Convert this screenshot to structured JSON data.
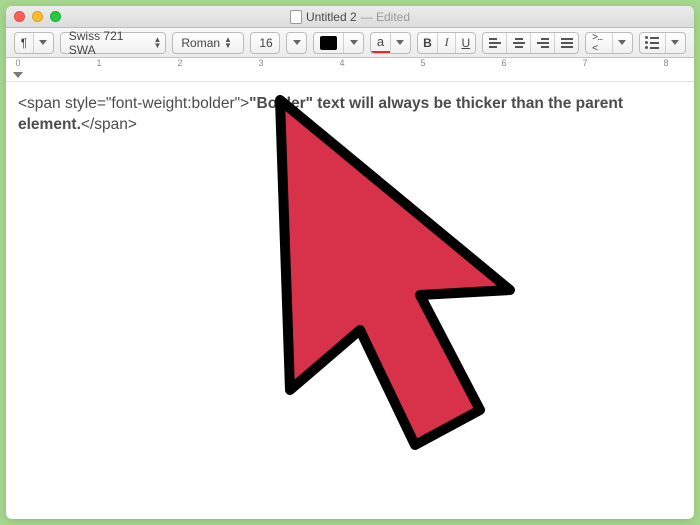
{
  "window": {
    "doc_title": "Untitled 2",
    "edited_suffix": "— Edited"
  },
  "toolbar": {
    "pilcrow": "¶",
    "font_family": "Swiss 721 SWA",
    "font_style": "Roman",
    "font_size": "16",
    "text_style_a": "a",
    "bold_label": "B",
    "italic_label": "I",
    "underline_label": "U",
    "spacing_label": ">...<"
  },
  "ruler": {
    "marks": [
      "0",
      "1",
      "2",
      "3",
      "4",
      "5",
      "6",
      "7",
      "8"
    ]
  },
  "document": {
    "line1_code_open": "<span style=\"font-weight:bolder\">",
    "line1_bold": "\"Bolder\" text will always be thicker than the parent",
    "line2_bold": "element.",
    "line2_code_close": "</span>"
  },
  "colors": {
    "cursor_fill": "#d8324a",
    "cursor_stroke": "#000000"
  }
}
